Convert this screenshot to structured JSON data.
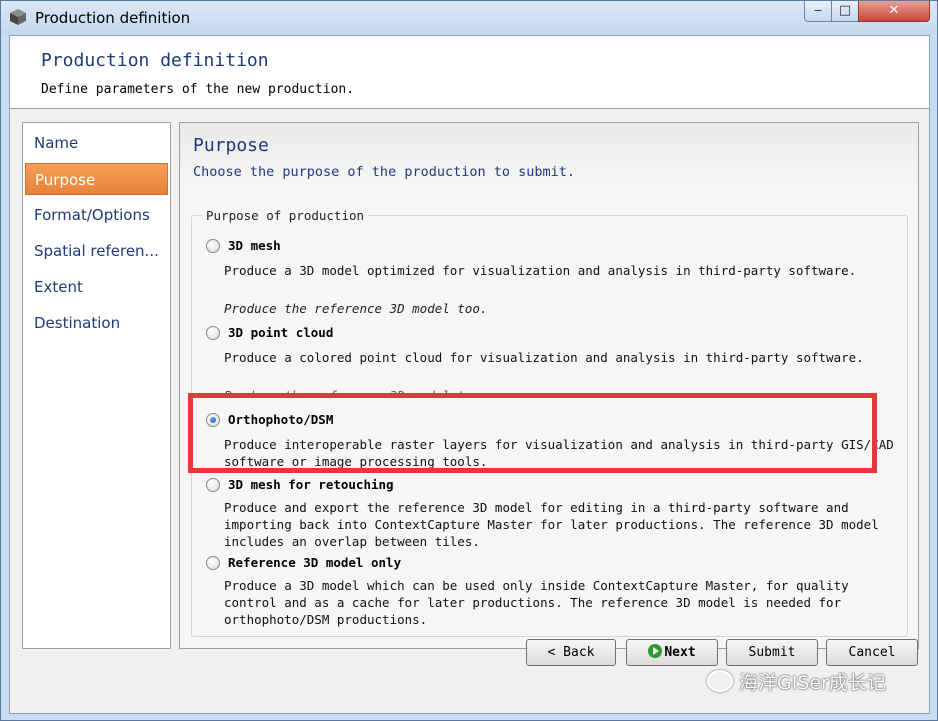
{
  "window": {
    "title": "Production definition",
    "minimize": "‒",
    "maximize": "□",
    "close": "✕"
  },
  "header": {
    "title": "Production definition",
    "subtitle": "Define parameters of the new production."
  },
  "sidebar": {
    "items": [
      {
        "label": "Name"
      },
      {
        "label": "Purpose"
      },
      {
        "label": "Format/Options"
      },
      {
        "label": "Spatial referen..."
      },
      {
        "label": "Extent"
      },
      {
        "label": "Destination"
      }
    ]
  },
  "main": {
    "title": "Purpose",
    "subtitle": "Choose the purpose of the production to submit.",
    "group_label": "Purpose of production",
    "options": [
      {
        "label": "3D mesh",
        "desc": "Produce a 3D model optimized for visualization and analysis in third-party software.",
        "extra": "Produce the reference 3D model too.",
        "selected": false
      },
      {
        "label": "3D point cloud",
        "desc": "Produce a colored point cloud for visualization and analysis in third-party software.",
        "extra": "Produce the reference 3D model too.",
        "selected": false
      },
      {
        "label": "Orthophoto/DSM",
        "desc": "Produce interoperable raster layers for visualization and analysis in third-party GIS/CAD software or image processing tools.",
        "selected": true
      },
      {
        "label": "3D mesh for retouching",
        "desc": "Produce and export the reference 3D model for editing in a third-party software and importing back into ContextCapture Master for later productions. The reference 3D model includes an overlap between tiles.",
        "selected": false
      },
      {
        "label": "Reference 3D model only",
        "desc": "Produce a 3D model which can be used only inside ContextCapture Master, for quality control and as a cache for later productions. The reference 3D model is needed for orthophoto/DSM productions.",
        "selected": false
      }
    ]
  },
  "footer": {
    "back": "< Back",
    "next": "Next",
    "submit": "Submit",
    "cancel": "Cancel"
  },
  "watermark": "海洋GISer成长记",
  "colors": {
    "accent": "#e8823a",
    "highlight": "#e8373c",
    "title": "#1f3a7a"
  }
}
